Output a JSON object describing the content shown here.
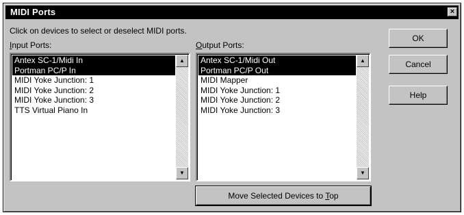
{
  "window": {
    "title": "MIDI Ports",
    "close_glyph": "×"
  },
  "instructions": "Click on devices to select or deselect MIDI ports.",
  "input_ports": {
    "label_underlined": "I",
    "label_rest": "nput Ports:",
    "items": [
      {
        "label": "Antex SC-1/Midi In",
        "selected": true
      },
      {
        "label": "Portman PC/P In",
        "selected": true
      },
      {
        "label": "MIDI Yoke Junction:  1",
        "selected": false
      },
      {
        "label": "MIDI Yoke Junction:  2",
        "selected": false
      },
      {
        "label": "MIDI Yoke Junction:  3",
        "selected": false
      },
      {
        "label": "TTS Virtual Piano In",
        "selected": false
      }
    ]
  },
  "output_ports": {
    "label_underlined": "O",
    "label_rest": "utput Ports:",
    "items": [
      {
        "label": "Antex SC-1/Midi Out",
        "selected": true
      },
      {
        "label": "Portman PC/P Out",
        "selected": true
      },
      {
        "label": "MIDI Mapper",
        "selected": false
      },
      {
        "label": "MIDI Yoke Junction:  1",
        "selected": false
      },
      {
        "label": "MIDI Yoke Junction:  2",
        "selected": false
      },
      {
        "label": "MIDI Yoke Junction:  3",
        "selected": false
      }
    ]
  },
  "buttons": {
    "ok": "OK",
    "cancel": "Cancel",
    "help": "Help",
    "move_prefix": "Move Selected Devices to ",
    "move_underlined": "T",
    "move_suffix": "op"
  },
  "icons": {
    "scroll_up": "▲",
    "scroll_down": "▼"
  }
}
